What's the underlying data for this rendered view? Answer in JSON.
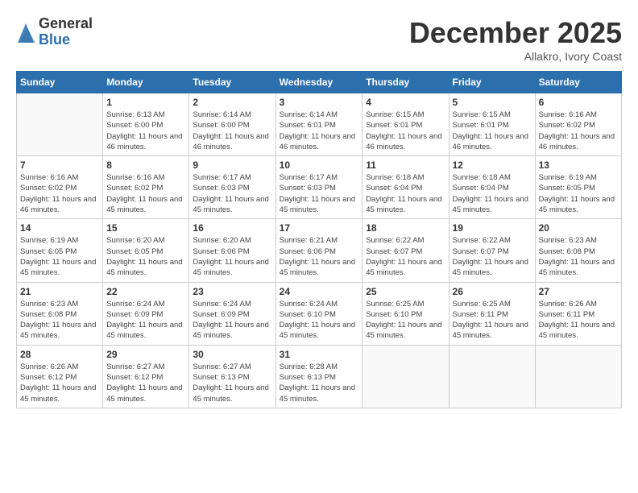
{
  "logo": {
    "general": "General",
    "blue": "Blue"
  },
  "title": "December 2025",
  "location": "Allakro, Ivory Coast",
  "weekdays": [
    "Sunday",
    "Monday",
    "Tuesday",
    "Wednesday",
    "Thursday",
    "Friday",
    "Saturday"
  ],
  "weeks": [
    [
      {
        "day": "",
        "detail": ""
      },
      {
        "day": "1",
        "detail": "Sunrise: 6:13 AM\nSunset: 6:00 PM\nDaylight: 11 hours and 46 minutes."
      },
      {
        "day": "2",
        "detail": "Sunrise: 6:14 AM\nSunset: 6:00 PM\nDaylight: 11 hours and 46 minutes."
      },
      {
        "day": "3",
        "detail": "Sunrise: 6:14 AM\nSunset: 6:01 PM\nDaylight: 11 hours and 46 minutes."
      },
      {
        "day": "4",
        "detail": "Sunrise: 6:15 AM\nSunset: 6:01 PM\nDaylight: 11 hours and 46 minutes."
      },
      {
        "day": "5",
        "detail": "Sunrise: 6:15 AM\nSunset: 6:01 PM\nDaylight: 11 hours and 46 minutes."
      },
      {
        "day": "6",
        "detail": "Sunrise: 6:16 AM\nSunset: 6:02 PM\nDaylight: 11 hours and 46 minutes."
      }
    ],
    [
      {
        "day": "7",
        "detail": "Sunrise: 6:16 AM\nSunset: 6:02 PM\nDaylight: 11 hours and 46 minutes."
      },
      {
        "day": "8",
        "detail": "Sunrise: 6:16 AM\nSunset: 6:02 PM\nDaylight: 11 hours and 45 minutes."
      },
      {
        "day": "9",
        "detail": "Sunrise: 6:17 AM\nSunset: 6:03 PM\nDaylight: 11 hours and 45 minutes."
      },
      {
        "day": "10",
        "detail": "Sunrise: 6:17 AM\nSunset: 6:03 PM\nDaylight: 11 hours and 45 minutes."
      },
      {
        "day": "11",
        "detail": "Sunrise: 6:18 AM\nSunset: 6:04 PM\nDaylight: 11 hours and 45 minutes."
      },
      {
        "day": "12",
        "detail": "Sunrise: 6:18 AM\nSunset: 6:04 PM\nDaylight: 11 hours and 45 minutes."
      },
      {
        "day": "13",
        "detail": "Sunrise: 6:19 AM\nSunset: 6:05 PM\nDaylight: 11 hours and 45 minutes."
      }
    ],
    [
      {
        "day": "14",
        "detail": "Sunrise: 6:19 AM\nSunset: 6:05 PM\nDaylight: 11 hours and 45 minutes."
      },
      {
        "day": "15",
        "detail": "Sunrise: 6:20 AM\nSunset: 6:05 PM\nDaylight: 11 hours and 45 minutes."
      },
      {
        "day": "16",
        "detail": "Sunrise: 6:20 AM\nSunset: 6:06 PM\nDaylight: 11 hours and 45 minutes."
      },
      {
        "day": "17",
        "detail": "Sunrise: 6:21 AM\nSunset: 6:06 PM\nDaylight: 11 hours and 45 minutes."
      },
      {
        "day": "18",
        "detail": "Sunrise: 6:22 AM\nSunset: 6:07 PM\nDaylight: 11 hours and 45 minutes."
      },
      {
        "day": "19",
        "detail": "Sunrise: 6:22 AM\nSunset: 6:07 PM\nDaylight: 11 hours and 45 minutes."
      },
      {
        "day": "20",
        "detail": "Sunrise: 6:23 AM\nSunset: 6:08 PM\nDaylight: 11 hours and 45 minutes."
      }
    ],
    [
      {
        "day": "21",
        "detail": "Sunrise: 6:23 AM\nSunset: 6:08 PM\nDaylight: 11 hours and 45 minutes."
      },
      {
        "day": "22",
        "detail": "Sunrise: 6:24 AM\nSunset: 6:09 PM\nDaylight: 11 hours and 45 minutes."
      },
      {
        "day": "23",
        "detail": "Sunrise: 6:24 AM\nSunset: 6:09 PM\nDaylight: 11 hours and 45 minutes."
      },
      {
        "day": "24",
        "detail": "Sunrise: 6:24 AM\nSunset: 6:10 PM\nDaylight: 11 hours and 45 minutes."
      },
      {
        "day": "25",
        "detail": "Sunrise: 6:25 AM\nSunset: 6:10 PM\nDaylight: 11 hours and 45 minutes."
      },
      {
        "day": "26",
        "detail": "Sunrise: 6:25 AM\nSunset: 6:11 PM\nDaylight: 11 hours and 45 minutes."
      },
      {
        "day": "27",
        "detail": "Sunrise: 6:26 AM\nSunset: 6:11 PM\nDaylight: 11 hours and 45 minutes."
      }
    ],
    [
      {
        "day": "28",
        "detail": "Sunrise: 6:26 AM\nSunset: 6:12 PM\nDaylight: 11 hours and 45 minutes."
      },
      {
        "day": "29",
        "detail": "Sunrise: 6:27 AM\nSunset: 6:12 PM\nDaylight: 11 hours and 45 minutes."
      },
      {
        "day": "30",
        "detail": "Sunrise: 6:27 AM\nSunset: 6:13 PM\nDaylight: 11 hours and 45 minutes."
      },
      {
        "day": "31",
        "detail": "Sunrise: 6:28 AM\nSunset: 6:13 PM\nDaylight: 11 hours and 45 minutes."
      },
      {
        "day": "",
        "detail": ""
      },
      {
        "day": "",
        "detail": ""
      },
      {
        "day": "",
        "detail": ""
      }
    ]
  ]
}
